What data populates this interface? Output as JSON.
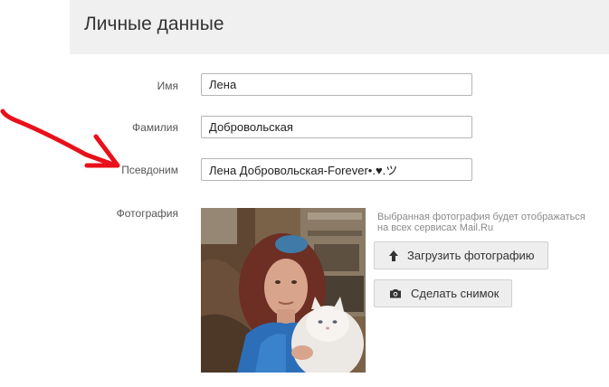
{
  "header": {
    "title": "Личные данные"
  },
  "form": {
    "first_name": {
      "label": "Имя",
      "value": "Лена"
    },
    "last_name": {
      "label": "Фамилия",
      "value": "Добровольская"
    },
    "nickname": {
      "label": "Псевдоним",
      "value": "Лена Добровольская-Forever•.♥.ツ"
    },
    "photo": {
      "label": "Фотография",
      "note": "Выбранная фотография будет отображаться на всех сервисах Mail.Ru",
      "upload_button": "Загрузить фотографию",
      "snapshot_button": "Сделать снимок"
    }
  },
  "icons": {
    "upload": "upload-arrow-icon",
    "camera": "camera-icon"
  },
  "colors": {
    "header_bg": "#f0f0f0",
    "annotation_arrow": "#e8101a",
    "button_bg": "#eeeeee"
  }
}
